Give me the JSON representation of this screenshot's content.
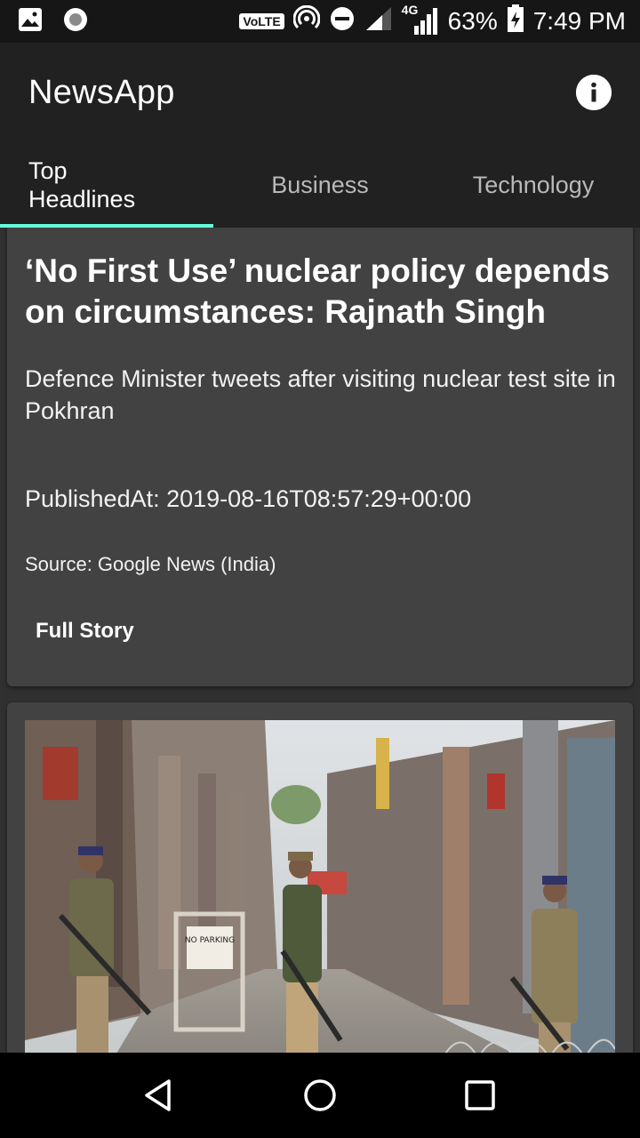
{
  "status_bar": {
    "network_label": "VoLTE",
    "signal_label": "4G",
    "battery": "63%",
    "time": "7:49 PM",
    "icons": [
      "image-icon",
      "circle-icon",
      "hotspot-icon",
      "dnd-icon",
      "signal-icon",
      "battery-icon"
    ]
  },
  "app_bar": {
    "title": "NewsApp",
    "info_icon": "info-icon"
  },
  "tabs": [
    {
      "label": "Top\nHeadlines",
      "line1": "Top",
      "line2": "Headlines",
      "selected": true
    },
    {
      "label": "Business",
      "selected": false
    },
    {
      "label": "Technology",
      "selected": false
    }
  ],
  "articles": [
    {
      "headline": "‘No First Use’ nuclear policy depends on circumstances: Rajnath Singh",
      "description": "Defence Minister tweets after visiting nuclear test site in Pokhran",
      "published": "PublishedAt: 2019-08-16T08:57:29+00:00",
      "source": "Source: Google News (India)",
      "action": "Full Story"
    },
    {
      "image": "street-with-soldiers-photo",
      "sign_text": "NO PARKING"
    }
  ],
  "nav_bar": {
    "icons": [
      "back-icon",
      "home-icon",
      "recents-icon"
    ]
  },
  "colors": {
    "accent": "#64ffda",
    "app_bar": "#212121",
    "card": "#424242",
    "background": "#303030"
  }
}
